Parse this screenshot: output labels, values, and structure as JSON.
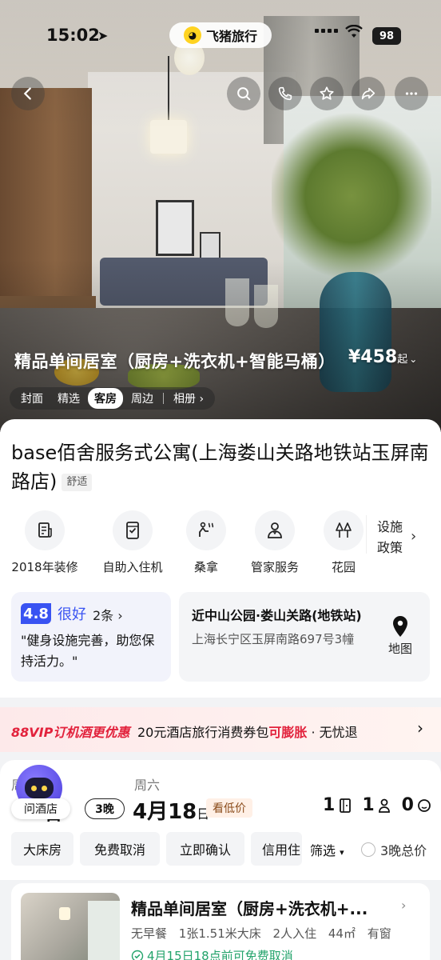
{
  "status_bar": {
    "time": "15:02",
    "battery": "98"
  },
  "brand": {
    "name": "飞猪旅行"
  },
  "hero": {
    "room_title": "精品单间居室（厨房+洗衣机+智能马桶）",
    "price": "¥458",
    "price_suffix": "起",
    "tabs": [
      "封面",
      "精选",
      "客房",
      "周边",
      "相册"
    ],
    "active_tab": "客房"
  },
  "hotel": {
    "name": "base佰舍服务式公寓(上海娄山关路地铁站玉屏南路店)",
    "tag": "舒适"
  },
  "facilities": [
    {
      "label": "2018年装修",
      "icon": "renovation-icon"
    },
    {
      "label": "自助入住机",
      "icon": "kiosk-icon"
    },
    {
      "label": "桑拿",
      "icon": "sauna-icon"
    },
    {
      "label": "管家服务",
      "icon": "butler-icon"
    },
    {
      "label": "花园",
      "icon": "garden-icon"
    }
  ],
  "policy": {
    "line1": "设施",
    "line2": "政策"
  },
  "review": {
    "score": "4.8",
    "word": "很好",
    "count": "2条",
    "quote": "\"健身设施完善，助您保持活力。\""
  },
  "location": {
    "name": "近中山公园·娄山关路(地铁站)",
    "address": "上海长宁区玉屏南路697号3幢",
    "map_label": "地图"
  },
  "promo": {
    "vip": "88VIP订机酒更优惠",
    "text_a": "20元酒店旅行消费券包",
    "text_highlight": "可膨胀",
    "text_b": " · 无忧退"
  },
  "booking": {
    "checkin_day": "周",
    "checkin_date": "日",
    "nights": "3晚",
    "checkout_day": "周六",
    "checkout_month": "4月",
    "checkout_day_num": "18",
    "checkout_suffix": "日",
    "cheaper_tag": "看低价",
    "rooms": "1",
    "adults": "1",
    "children": "0"
  },
  "assistant": {
    "label": "问酒店"
  },
  "filters": {
    "chips": [
      "大床房",
      "免费取消",
      "立即确认",
      "信用住"
    ],
    "sort": "筛选",
    "total_toggle": "3晚总价"
  },
  "room": {
    "title": "精品单间居室（厨房+洗衣机+...",
    "meta": [
      "无早餐",
      "1张1.51米大床",
      "2人入住",
      "44㎡",
      "有窗"
    ],
    "cancel": "4月15日18点前可免费取消"
  },
  "colors": {
    "accent_blue": "#3953f2",
    "promo_red": "#e2223c",
    "cancel_green": "#23a36b"
  }
}
